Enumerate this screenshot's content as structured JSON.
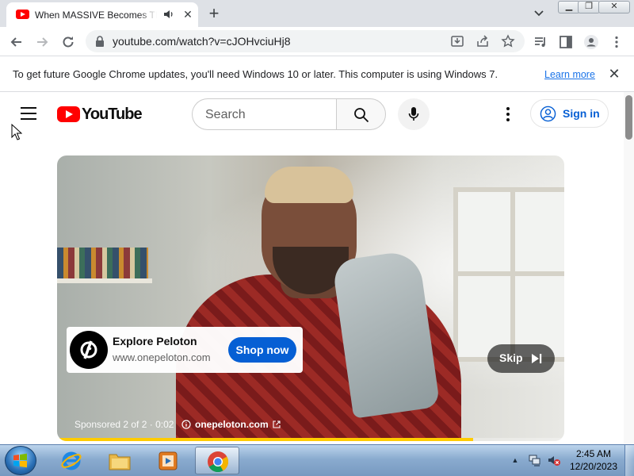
{
  "browser": {
    "tab_title": "When MASSIVE Becomes TINY",
    "address": "youtube.com/watch?v=cJOHvciuHj8"
  },
  "infobar": {
    "message": "To get future Google Chrome updates, you'll need Windows 10 or later. This computer is using Windows 7.",
    "link": "Learn more"
  },
  "youtube": {
    "logo_text": "YouTube",
    "search_placeholder": "Search",
    "sign_in": "Sign in"
  },
  "ad": {
    "title": "Explore Peloton",
    "domain": "www.onepeloton.com",
    "cta": "Shop now",
    "skip": "Skip",
    "sponsored": "Sponsored 2 of 2",
    "time": "0:02",
    "url": "onepeloton.com",
    "progress": 0.82,
    "cta_color": "#065fd4",
    "progress_color": "#ffcc00"
  },
  "taskbar": {
    "time": "2:45 AM",
    "date": "12/20/2023",
    "pinned": [
      "internet-explorer-icon",
      "file-explorer-icon",
      "media-player-icon",
      "chrome-icon"
    ]
  }
}
